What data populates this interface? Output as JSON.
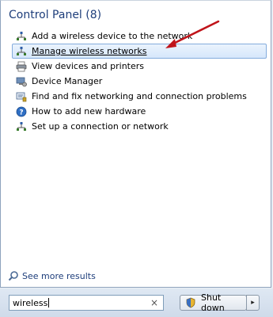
{
  "header": {
    "title": "Control Panel (8)"
  },
  "results": [
    {
      "label": "Add a wireless device to the network",
      "icon": "wireless-network-icon",
      "selected": false
    },
    {
      "label": "Manage wireless networks",
      "icon": "wireless-network-icon",
      "selected": true
    },
    {
      "label": "View devices and printers",
      "icon": "printer-icon",
      "selected": false
    },
    {
      "label": "Device Manager",
      "icon": "device-manager-icon",
      "selected": false
    },
    {
      "label": "Find and fix networking and connection problems",
      "icon": "troubleshoot-icon",
      "selected": false
    },
    {
      "label": "How to add new hardware",
      "icon": "help-icon",
      "selected": false
    },
    {
      "label": "Set up a connection or network",
      "icon": "wireless-network-icon",
      "selected": false
    }
  ],
  "see_more": {
    "label": "See more results"
  },
  "search": {
    "value": "wireless",
    "clear_glyph": "×"
  },
  "shutdown": {
    "label": "Shut down",
    "arrow_glyph": "▸"
  },
  "colors": {
    "header": "#1e3e7b",
    "selection_border": "#84acdd",
    "annotation_arrow": "#c0141a"
  }
}
